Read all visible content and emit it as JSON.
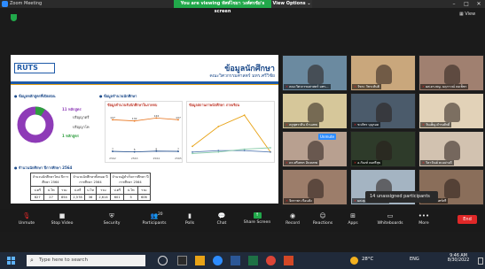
{
  "window": {
    "title": "Zoom Meeting",
    "minimize": "–",
    "maximize": "□",
    "close": "✕"
  },
  "banner": {
    "viewing_text": "You are viewing ทัศพ์ไชยา วงศ์ศรชัย's screen",
    "view_options": "View Options ⌄"
  },
  "top_right": {
    "view_label": "View"
  },
  "slide": {
    "logo_text": "RUTS",
    "title": "ข้อมูลนักศึกษา",
    "subtitle": "คณะวิศวกรรมศาสตร์ มทร.ศรีวิชัย",
    "sec1_title": "ข้อมูลหลักสูตรที่เปิดสอน",
    "donut": {
      "outer_label": "11 หลักสูตร",
      "outer_caption": "ปริญญาตรี",
      "inner_label": "1 หลักสูตร",
      "inner_caption": "ปริญญาโท",
      "values": [
        11,
        1
      ],
      "colors": [
        "#8e3bb7",
        "#2f9e3f"
      ]
    },
    "sec2_title": "ข้อมูลจำนวนนักศึกษา",
    "chart_a": {
      "title": "ข้อมูลจำนวนรับนักศึกษาในภาคจบ",
      "x": [
        "2562",
        "2563",
        "2564",
        "2565"
      ],
      "series": [
        {
          "color": "#e87722",
          "values": [
            137,
            132,
            144,
            137
          ]
        },
        {
          "color": "#1c4a8a",
          "values": [
            7,
            5,
            8,
            7
          ]
        }
      ],
      "labels_top": [
        "137",
        "132",
        "144",
        "137"
      ],
      "labels_bottom": [
        "7",
        "5",
        "8",
        "7"
      ]
    },
    "chart_b": {
      "title": "ข้อมูลสถานภาพนักศึกษา ภาคเรียน",
      "series": [
        {
          "color": "#e8a317",
          "values": [
            6,
            20,
            28,
            2
          ]
        },
        {
          "color": "#5b7fb5",
          "values": [
            2,
            3,
            3,
            2
          ]
        },
        {
          "color": "#8ca",
          "values": [
            1,
            2,
            4,
            5
          ]
        }
      ]
    },
    "sec3_title": "จำนวนนักศึกษา ปีการศึกษา 2564",
    "table": {
      "group_headers": [
        "จำนวนนักศึกษาใหม่ ปีการศึกษา 2564",
        "จำนวนนักศึกษาทั้งหมด ปีการศึกษา 2564",
        "จำนวนผู้สำเร็จการศึกษา ปีการศึกษา 2564"
      ],
      "sub_headers": [
        "ป.ตรี",
        "ป.โท",
        "รวม",
        "ป.ตรี",
        "ป.โท",
        "รวม",
        "ป.ตรี",
        "ป.โท",
        "รวม"
      ],
      "values": [
        "827",
        "27",
        "854",
        "2,578",
        "36",
        "2,614",
        "601",
        "5",
        "606"
      ]
    }
  },
  "participants": [
    {
      "name": "คณะวิศวกรรมศาสตร์ มทร...",
      "muted": true
    },
    {
      "name": "วัชระ วัชระสันติ",
      "muted": true
    },
    {
      "name": "ผศ.ดร.พญ. นฤกาวณ์ คงเพ็ชร",
      "muted": true
    },
    {
      "name": "ครูพุทราสิน บ้านเทพ",
      "muted": true
    },
    {
      "name": "ชวภัทร บุญรอด",
      "muted": true
    },
    {
      "name": "วันเพ็ญ ดำรงศักดิ์",
      "muted": true
    },
    {
      "name": "ดร.ศรีเพชร อินทเทพ",
      "muted": true
    },
    {
      "name": "อ.กัณฑ์ คงศรีสุข",
      "muted": true
    },
    {
      "name": "วิลาวัณย์ ตะอย่างดี",
      "muted": true
    },
    {
      "name": "จิตราพร เรือนสัง",
      "muted": true
    },
    {
      "name": "ผศ.ศุภพงศ์ มั่นศรีจรูญ",
      "muted": true
    },
    {
      "name": "ปัทมา จันทร์ศรี",
      "muted": true
    }
  ],
  "pin_label": "Unmute",
  "unassigned": "14 unassigned participants",
  "toolbar": [
    {
      "label": "Unmute",
      "icon": "mic-muted-icon",
      "glyph": "🎙"
    },
    {
      "label": "Stop Video",
      "icon": "video-icon",
      "glyph": "■"
    },
    {
      "label": "Security",
      "icon": "shield-icon",
      "glyph": "⛨"
    },
    {
      "label": "Participants",
      "icon": "participants-icon",
      "glyph": "👥",
      "count": "20"
    },
    {
      "label": "Polls",
      "icon": "polls-icon",
      "glyph": "▮"
    },
    {
      "label": "Chat",
      "icon": "chat-icon",
      "glyph": "💬"
    },
    {
      "label": "Share Screen",
      "icon": "share-screen-icon",
      "glyph": "↑"
    },
    {
      "label": "Record",
      "icon": "record-icon",
      "glyph": "◉"
    },
    {
      "label": "Reactions",
      "icon": "reactions-icon",
      "glyph": "☺"
    },
    {
      "label": "Apps",
      "icon": "apps-icon",
      "glyph": "⊞"
    },
    {
      "label": "Whiteboards",
      "icon": "whiteboard-icon",
      "glyph": "▭"
    },
    {
      "label": "More",
      "icon": "more-icon",
      "glyph": "•••"
    }
  ],
  "end_label": "End",
  "taskbar": {
    "search_placeholder": "Type here to search",
    "temperature": "28°C",
    "lang": "ENG",
    "time": "9:46 AM",
    "date": "8/30/2022"
  }
}
